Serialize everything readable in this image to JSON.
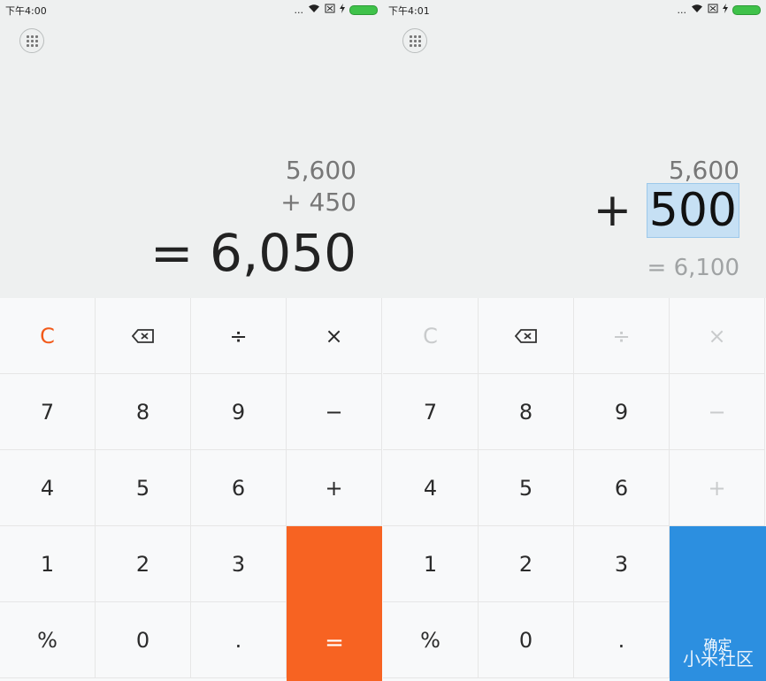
{
  "left": {
    "status": {
      "time": "下午4:00",
      "icons_text": "..."
    },
    "display": {
      "operand1": "5,600",
      "operator_line": "+  450",
      "result": "= 6,050"
    },
    "keys": {
      "clear": "C",
      "divide": "÷",
      "multiply": "×",
      "seven": "7",
      "eight": "8",
      "nine": "9",
      "minus": "−",
      "four": "4",
      "five": "5",
      "six": "6",
      "plus": "+",
      "one": "1",
      "two": "2",
      "three": "3",
      "percent": "%",
      "zero": "0",
      "dot": ".",
      "equals": "="
    }
  },
  "right": {
    "status": {
      "time": "下午4:01",
      "icons_text": "..."
    },
    "display": {
      "operand1": "5,600",
      "operator": "+",
      "current_input": "500",
      "preview": "=  6,100"
    },
    "keys": {
      "clear": "C",
      "divide": "÷",
      "multiply": "×",
      "seven": "7",
      "eight": "8",
      "nine": "9",
      "minus": "−",
      "four": "4",
      "five": "5",
      "six": "6",
      "plus": "+",
      "one": "1",
      "two": "2",
      "three": "3",
      "percent": "%",
      "zero": "0",
      "dot": ".",
      "confirm": "确定"
    }
  },
  "watermark": "小米社区",
  "colors": {
    "accent_orange": "#f76322",
    "accent_blue": "#2c8fe0"
  }
}
